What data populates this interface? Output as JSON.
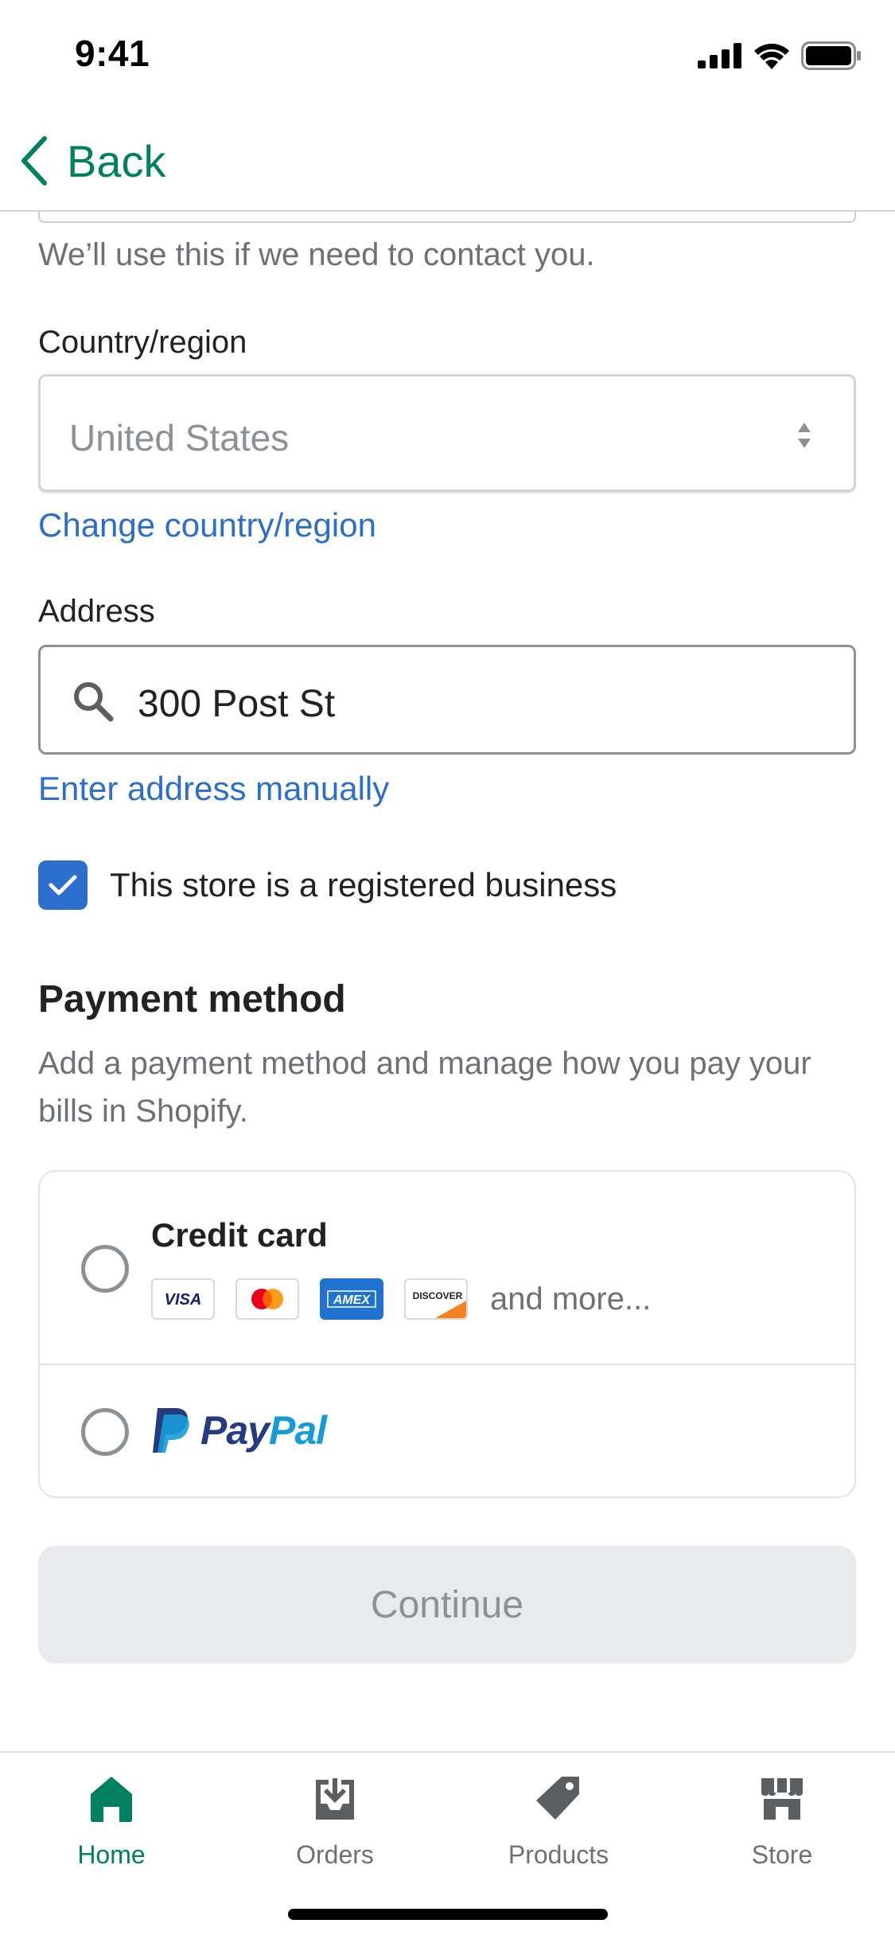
{
  "status_bar": {
    "time": "9:41"
  },
  "nav": {
    "back_label": "Back"
  },
  "contact": {
    "help_text": "We’ll use this if we need to contact you."
  },
  "country": {
    "label": "Country/region",
    "value": "United States",
    "change_link": "Change country/region"
  },
  "address": {
    "label": "Address",
    "value": "300 Post St",
    "manual_link": "Enter address manually"
  },
  "business_checkbox": {
    "label": "This store is a registered business",
    "checked": true
  },
  "payment": {
    "title": "Payment method",
    "description": "Add a payment method and manage how you pay your bills in Shopify.",
    "options": [
      {
        "label": "Credit card",
        "selected": false,
        "card_logos": [
          "VISA",
          "mastercard",
          "AMEX",
          "DISCOVER"
        ],
        "more_text": "and more..."
      },
      {
        "label": "PayPal",
        "selected": false,
        "logo_parts": [
          "Pay",
          "Pal"
        ]
      }
    ]
  },
  "continue_button": {
    "label": "Continue",
    "disabled": true
  },
  "tab_bar": {
    "tabs": [
      {
        "label": "Home",
        "icon": "home-icon",
        "active": true
      },
      {
        "label": "Orders",
        "icon": "orders-icon",
        "active": false
      },
      {
        "label": "Products",
        "icon": "tag-icon",
        "active": false
      },
      {
        "label": "Store",
        "icon": "store-icon",
        "active": false
      }
    ]
  },
  "colors": {
    "brand_green": "#008060",
    "link_blue": "#2c6ecb",
    "checkbox_blue": "#2c6ecb",
    "paypal_dark": "#253b80",
    "paypal_light": "#179bd7",
    "amex_blue": "#1f72cd",
    "discover_orange": "#f58220"
  }
}
